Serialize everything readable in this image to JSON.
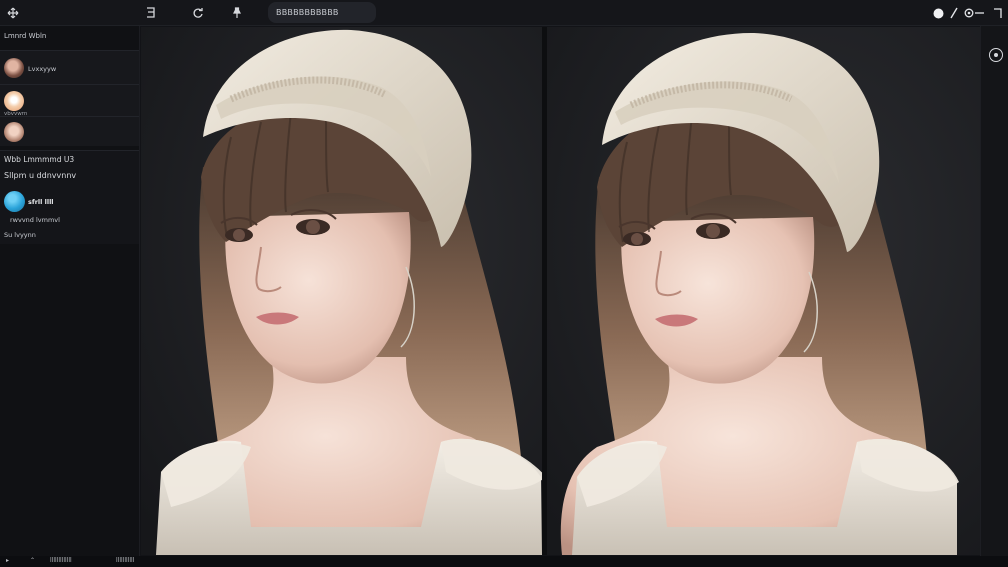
{
  "toolbar": {
    "app_icon": "move-icon",
    "tool_1": "layers-icon",
    "tool_2": "rotate-icon",
    "tool_3": "pin-icon",
    "field_value": "BBBBBBBBBBB",
    "right_circle": "●",
    "right_pen": "/",
    "right_settings": "⊙—",
    "right_window": "⌐"
  },
  "sidebar": {
    "title": "Lmnrd Wbln",
    "items": [
      {
        "label": "Lvxxyyw",
        "avatar_color": "#8a5a4e"
      },
      {
        "label": "",
        "avatar_color": "#f2c9a8"
      },
      {
        "label": "vbvvwrn",
        "avatar_color": "#b0826f"
      }
    ],
    "group_heading": "Wbb Lmmmmd U3",
    "group_sub": "Sllpm u ddnvvnnv",
    "group_avatar_color": "#2aa3d9",
    "group_line_1": "sfrll llll",
    "group_line_2": "rwvvnd lvmmvl",
    "group_line_3": "Su lvyynn"
  },
  "canvas": {
    "left_panel": "portrait-original",
    "right_panel": "portrait-edited",
    "background": "#1e1f22"
  },
  "status": {
    "item_1": "lllllllllllll",
    "item_2": "lllllllllll"
  },
  "colors": {
    "accent": "#2aa3d9",
    "hat": "#e8e1d3",
    "hair": "#6e5444",
    "skin": "#e9c9bb",
    "dress": "#ece6dd"
  }
}
